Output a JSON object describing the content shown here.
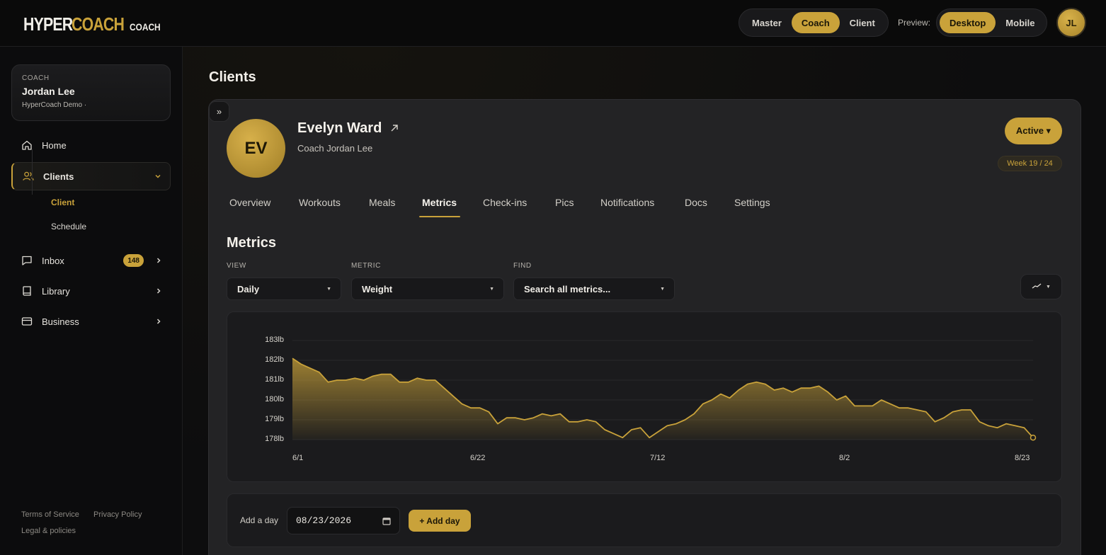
{
  "brand": {
    "logo_main": "HYPER",
    "logo_accent": "COACH",
    "logo_role": "COACH"
  },
  "role_switch": {
    "options": [
      "Master",
      "Coach",
      "Client"
    ],
    "selected": "Coach"
  },
  "preview": {
    "label": "Preview:",
    "options": [
      "Desktop",
      "Mobile"
    ],
    "selected": "Desktop"
  },
  "user": {
    "initials": "JL"
  },
  "sidebar": {
    "coach_card": {
      "kicker": "COACH",
      "name": "Jordan Lee",
      "org": "HyperCoach Demo ·"
    },
    "items": [
      {
        "label": "Home",
        "icon": "home-icon"
      },
      {
        "label": "Clients",
        "icon": "users-icon",
        "expanded": true
      },
      {
        "label": "Inbox",
        "icon": "chat-icon",
        "badge": "148"
      },
      {
        "label": "Library",
        "icon": "book-icon"
      },
      {
        "label": "Business",
        "icon": "card-icon"
      }
    ],
    "sub_items": [
      {
        "label": "Client",
        "active": true
      },
      {
        "label": "Schedule"
      }
    ],
    "footer": {
      "terms": "Terms of Service",
      "privacy": "Privacy Policy",
      "legal": "Legal & policies"
    }
  },
  "page": {
    "title": "Clients",
    "collapse_glyph": "»"
  },
  "client": {
    "initials": "EV",
    "name": "Evelyn Ward",
    "coach": "Coach Jordan Lee",
    "status": "Active ▾",
    "week": "Week 19 / 24"
  },
  "tabs": [
    "Overview",
    "Workouts",
    "Meals",
    "Metrics",
    "Check-ins",
    "Pics",
    "Notifications",
    "Docs",
    "Settings"
  ],
  "active_tab": "Metrics",
  "metrics": {
    "title": "Metrics",
    "view": {
      "label": "VIEW",
      "value": "Daily"
    },
    "metric": {
      "label": "METRIC",
      "value": "Weight"
    },
    "find": {
      "label": "FIND",
      "value": "Search all metrics..."
    }
  },
  "add_day": {
    "label": "Add a day",
    "date": "08/23/2026",
    "button": "+ Add day"
  },
  "colors": {
    "accent": "#c9a23a",
    "panel": "#232325",
    "background": "#0b0b0c"
  },
  "chart_data": {
    "type": "area",
    "unit": "lb",
    "yticks": [
      "183lb",
      "182lb",
      "181lb",
      "180lb",
      "179lb",
      "178lb"
    ],
    "xticks": [
      "6/1",
      "6/22",
      "7/12",
      "8/2",
      "8/23"
    ],
    "ylim": [
      178,
      183
    ],
    "start": "6/1",
    "end": "8/23",
    "values": [
      182.1,
      181.8,
      181.6,
      181.4,
      180.9,
      181.0,
      181.0,
      181.1,
      181.0,
      181.2,
      181.3,
      181.3,
      180.9,
      180.9,
      181.1,
      181.0,
      181.0,
      180.6,
      180.2,
      179.8,
      179.6,
      179.6,
      179.4,
      178.8,
      179.1,
      179.1,
      179.0,
      179.1,
      179.3,
      179.2,
      179.3,
      178.9,
      178.9,
      179.0,
      178.9,
      178.5,
      178.3,
      178.1,
      178.5,
      178.6,
      178.1,
      178.4,
      178.7,
      178.8,
      179.0,
      179.3,
      179.8,
      180.0,
      180.3,
      180.1,
      180.5,
      180.8,
      180.9,
      180.8,
      180.5,
      180.6,
      180.4,
      180.6,
      180.6,
      180.7,
      180.4,
      180.0,
      180.2,
      179.7,
      179.7,
      179.7,
      180.0,
      179.8,
      179.6,
      179.6,
      179.5,
      179.4,
      178.9,
      179.1,
      179.4,
      179.5,
      179.5,
      178.9,
      178.7,
      178.6,
      178.8,
      178.7,
      178.6,
      178.1
    ]
  }
}
